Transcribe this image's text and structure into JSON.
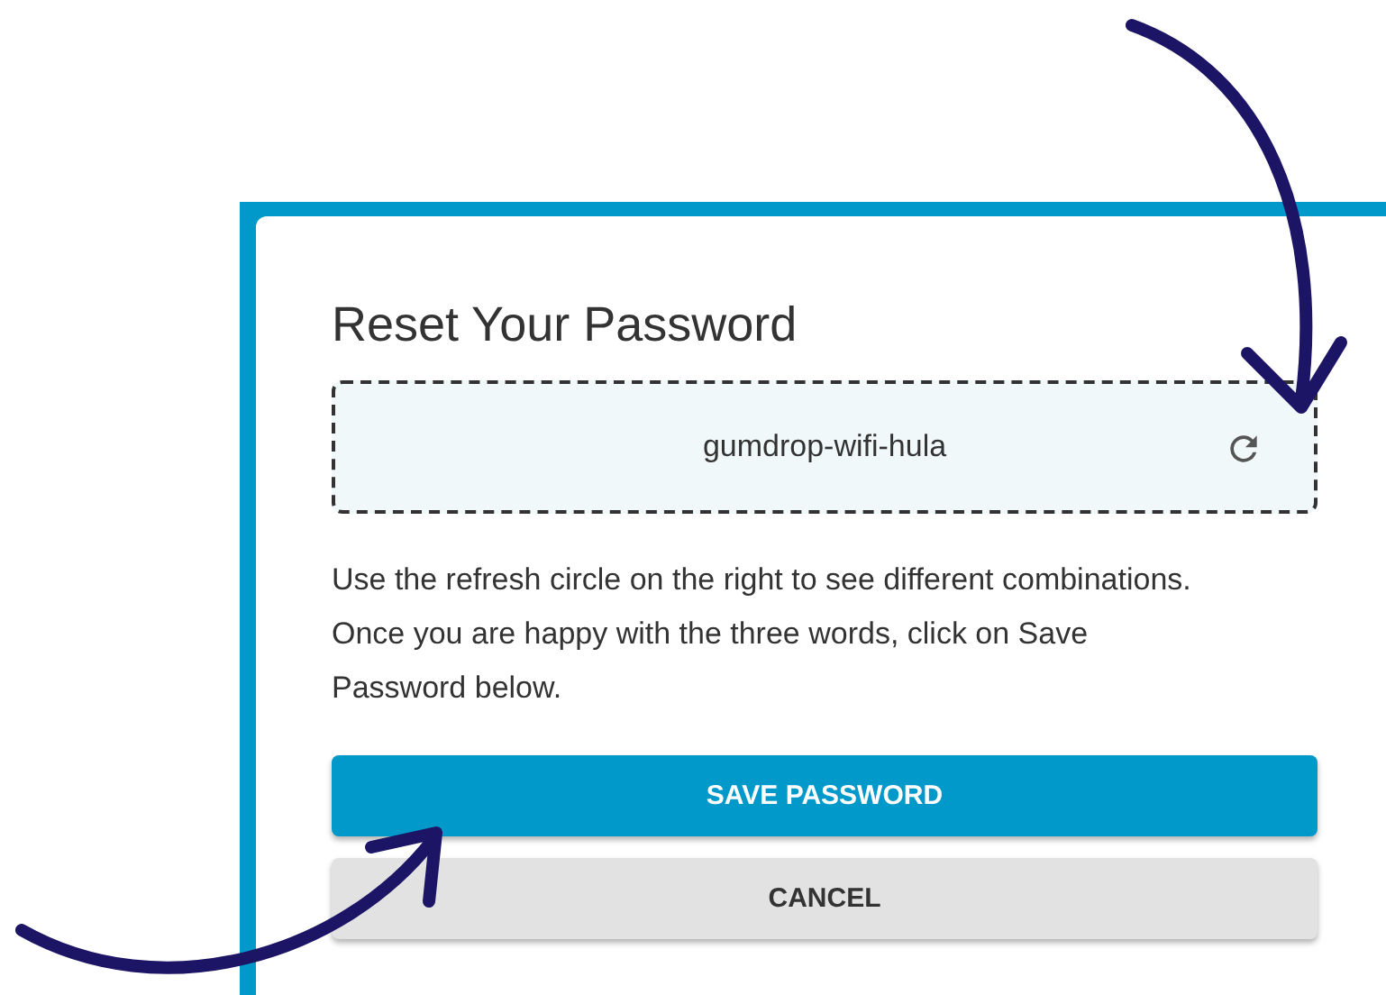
{
  "dialog": {
    "title": "Reset Your Password",
    "password": {
      "value": "gumdrop-wifi-hula"
    },
    "instructions": "Use the refresh circle on the right to see different combinations. Once you are happy with the three words, click on Save Password below.",
    "buttons": [
      {
        "label": "SAVE PASSWORD",
        "kind": "primary"
      },
      {
        "label": "CANCEL",
        "kind": "secondary"
      }
    ]
  }
}
